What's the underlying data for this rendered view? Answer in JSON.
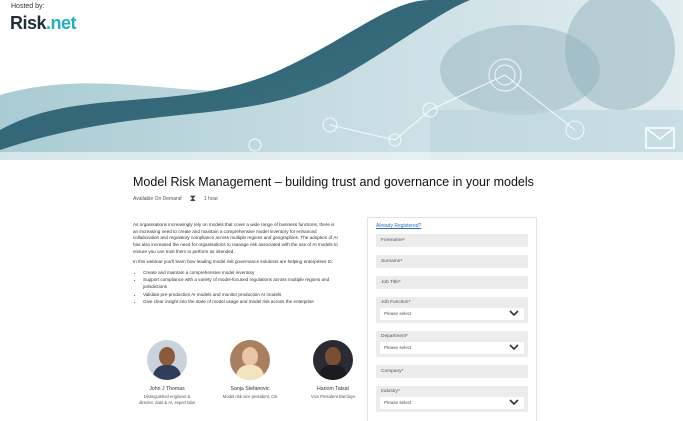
{
  "header": {
    "hosted_by": "Hosted by:",
    "logo_main": "Risk",
    "logo_suffix": ".net"
  },
  "event": {
    "title": "Model Risk Management – building trust and governance in your models",
    "availability": "Available On Demand",
    "duration": "1 hour"
  },
  "description": {
    "intro": "As organisations increasingly rely on models that cover a wide range of business functions, there is an increasing need to create and maintain a comprehensive model inventory for enhanced collaboration and regulatory compliance across multiple regions and geographies. The adoption of AI has also increased the need for organisations to manage risk associated with the use of AI models to ensure you can trust them to perform as intended.",
    "lead_in": "In this webinar you'll learn how leading model risk governance solutions are helping enterprises to:",
    "bullets": [
      "Create and maintain a comprehensive model inventory",
      "Support compliance with a variety of model-focused regulations across multiple regions and jurisdictions",
      "Validate pre-production AI models and monitor production AI models",
      "Give clear insight into the state of model usage and model risk across the enterprise"
    ]
  },
  "speakers": [
    {
      "name": "John J Thomas",
      "role": "Distinguished engineer & director, data & AI, expert labs"
    },
    {
      "name": "Sanja Stefanovic",
      "role": "Model risk vice president, Citi"
    },
    {
      "name": "Hariom Tatsat",
      "role": "Vice President Barclays"
    }
  ],
  "form": {
    "already_registered": "Already Registered?",
    "forename": "Forename*",
    "surname": "Surname*",
    "job_title": "Job Title*",
    "job_function_label": "Job Function*",
    "job_function_value": "Please select",
    "department_label": "Department*",
    "department_value": "Please select",
    "company": "Company*",
    "industry_label": "Industry*",
    "industry_value": "Please select"
  },
  "colors": {
    "teal": "#1fb3b8",
    "hero_wave": "#2f5c6e",
    "link": "#2a6fc1"
  }
}
